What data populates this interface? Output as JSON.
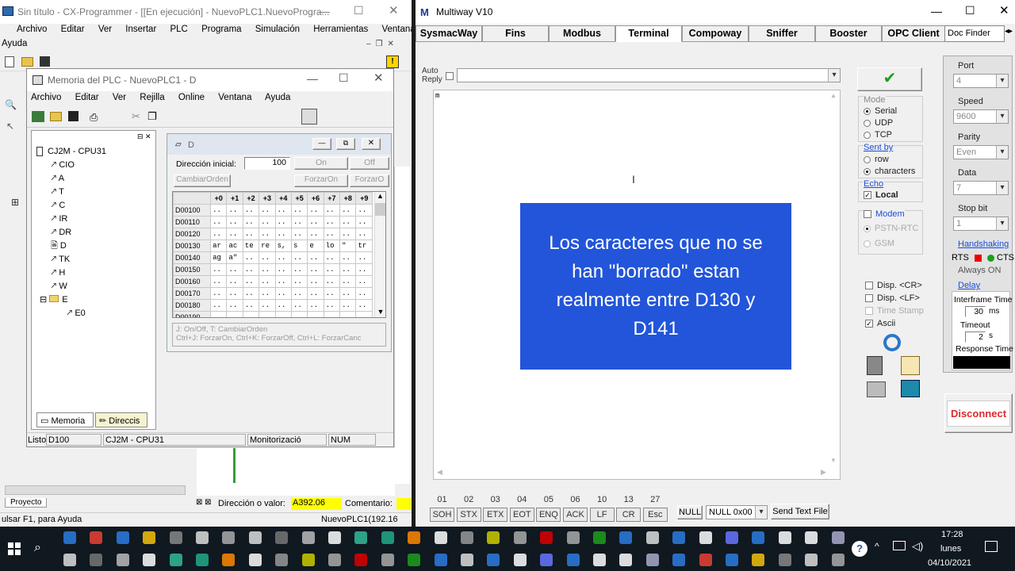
{
  "cx": {
    "title": "Sin título - CX-Programmer - [[En ejecución] - NuevoPLC1.NuevoProgra...",
    "menu": [
      "Archivo",
      "Editar",
      "Ver",
      "Insertar",
      "PLC",
      "Programa",
      "Simulación",
      "Herramientas",
      "Ventana"
    ],
    "help_menu": "Ayuda",
    "project_tab": "Proyecto",
    "status_left": "ulsar F1, para Ayuda",
    "status_right": "NuevoPLC1(192.16",
    "addr_label": "Dirección o valor:",
    "addr_value": "A392.06",
    "comment_label": "Comentario:"
  },
  "mem": {
    "title": "Memoria del PLC - NuevoPLC1 - D",
    "menu": [
      "Archivo",
      "Editar",
      "Ver",
      "Rejilla",
      "Online",
      "Ventana",
      "Ayuda"
    ],
    "tree_root": "CJ2M - CPU31",
    "tree_items": [
      "CIO",
      "A",
      "T",
      "C",
      "IR",
      "DR",
      "D",
      "TK",
      "H",
      "W",
      "E",
      "E0"
    ],
    "tab_memoria": "Memoria",
    "tab_direcc": "Direccis",
    "status": [
      "Listo",
      "D100",
      "CJ2M - CPU31",
      "Monitorizació",
      "NUM"
    ]
  },
  "d": {
    "title": "D",
    "dir_label": "Dirección inicial:",
    "dir_value": "100",
    "btn_on": "On",
    "btn_off": "Off",
    "btn_cambiar": "CambiarOrden",
    "btn_forzar_on": "ForzarOn",
    "btn_forzar_off": "ForzarO",
    "cols": [
      "",
      "+0",
      "+1",
      "+2",
      "+3",
      "+4",
      "+5",
      "+6",
      "+7",
      "+8",
      "+9"
    ],
    "rows": [
      [
        "D00100",
        "..",
        "..",
        "..",
        "..",
        "..",
        "..",
        "..",
        "..",
        "..",
        ".."
      ],
      [
        "D00110",
        "..",
        "..",
        "..",
        "..",
        "..",
        "..",
        "..",
        "..",
        "..",
        ".."
      ],
      [
        "D00120",
        "..",
        "..",
        "..",
        "..",
        "..",
        "..",
        "..",
        "..",
        "..",
        ".."
      ],
      [
        "D00130",
        "ar",
        "ac",
        "te",
        "re",
        "s,",
        "s",
        "e",
        "lo",
        "\"",
        "tr"
      ],
      [
        "D00140",
        "ag",
        "a\"",
        "..",
        "..",
        "..",
        "..",
        "..",
        "..",
        "..",
        ".."
      ],
      [
        "D00150",
        "..",
        "..",
        "..",
        "..",
        "..",
        "..",
        "..",
        "..",
        "..",
        ".."
      ],
      [
        "D00160",
        "..",
        "..",
        "..",
        "..",
        "..",
        "..",
        "..",
        "..",
        "..",
        ".."
      ],
      [
        "D00170",
        "..",
        "..",
        "..",
        "..",
        "..",
        "..",
        "..",
        "..",
        "..",
        ".."
      ],
      [
        "D00180",
        "..",
        "..",
        "..",
        "..",
        "..",
        "..",
        "..",
        "..",
        "..",
        ".."
      ],
      [
        "D00190",
        "",
        "",
        "",
        "",
        "",
        "",
        "",
        "",
        "",
        ""
      ]
    ],
    "hint1": "J: On/Off,    T: CambiarOrden",
    "hint2": "Ctrl+J: ForzarOn,    Ctrl+K: ForzarOff,    Ctrl+L: ForzarCanc"
  },
  "mw": {
    "title": "Multiway V10",
    "tabs": [
      "SysmacWay",
      "Fins",
      "Modbus",
      "Terminal",
      "Compoway",
      "Sniffer",
      "Booster",
      "OPC Client"
    ],
    "doc_finder": "Doc Finder",
    "auto_reply": "Auto Reply",
    "terminal_text": "m",
    "overlay": "Los caracteres que no se han \"borrado\" estan realmente entre D130 y D141",
    "mode_label": "Mode",
    "modes": [
      "Serial",
      "UDP",
      "TCP"
    ],
    "sentby_label": "Sent by",
    "sentby": [
      "row",
      "characters"
    ],
    "echo_label": "Echo",
    "echo_local": "Local",
    "modem_label": "Modem",
    "modem_opts": [
      "PSTN-RTC",
      "GSM"
    ],
    "disp_cr": "Disp. <CR>",
    "disp_lf": "Disp. <LF>",
    "time_stamp": "Time Stamp",
    "ascii": "Ascii",
    "port_label": "Port",
    "port_value": "4",
    "speed_label": "Speed",
    "speed_value": "9600",
    "parity_label": "Parity",
    "parity_value": "Even",
    "data_label": "Data",
    "data_value": "7",
    "stopbit_label": "Stop bit",
    "stopbit_value": "1",
    "handshaking": "Handshaking",
    "rts": "RTS",
    "cts": "CTS",
    "always_on": "Always ON",
    "delay": "Delay",
    "interframe": "Interframe Time",
    "interframe_value": "30",
    "ms": "ms",
    "timeout": "Timeout",
    "timeout_value": "2",
    "s": "s",
    "response_time": "Response Time",
    "disconnect": "Disconnect",
    "ctl_nums": [
      "01",
      "02",
      "03",
      "04",
      "05",
      "06",
      "10",
      "13",
      "27"
    ],
    "ctl_names": [
      "SOH",
      "STX",
      "ETX",
      "EOT",
      "ENQ",
      "ACK",
      "LF",
      "CR",
      "Esc"
    ],
    "null_btn": "NULL",
    "null_combo": "NULL 0x00",
    "send_text_file": "Send Text File",
    "colors": {
      "accent_blue": "#2255d9",
      "disconnect_red": "#e0282e",
      "check_green": "#1ca01c"
    }
  },
  "taskbar": {
    "time": "17:28",
    "day": "lunes",
    "date": "04/10/2021"
  }
}
